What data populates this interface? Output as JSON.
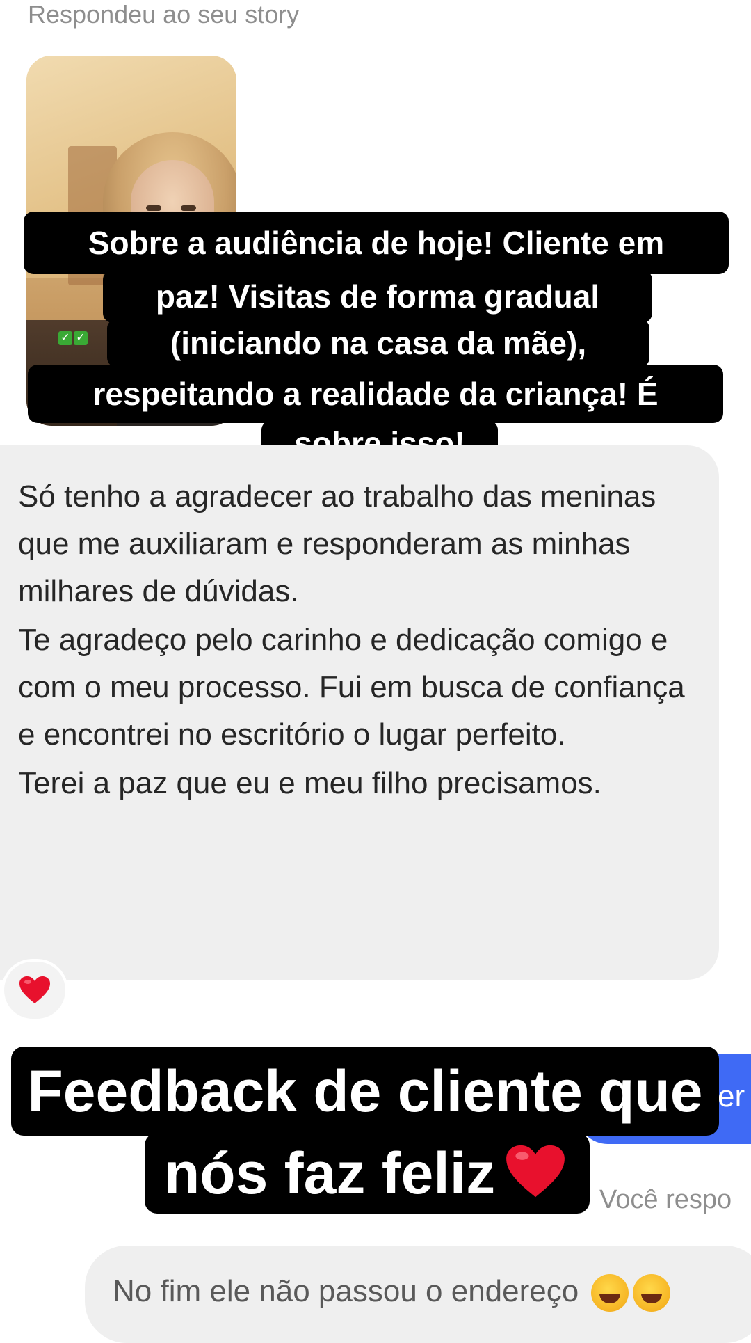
{
  "story_reply": {
    "label": "Respondeu ao seu story",
    "caption_lines": [
      "Sobre a audiência de hoje! Cliente em",
      "paz! Visitas de forma gradual",
      "(iniciando na casa da mãe),",
      "respeitando a realidade da criança! É",
      "sobre isso!"
    ],
    "check_emojis": "✅✅"
  },
  "message": {
    "paragraphs": [
      "Só tenho a agradecer ao trabalho das meninas que me auxiliaram e responderam as minhas milhares de dúvidas.",
      "Te agradeço pelo carinho e dedicação comigo e com o meu processo. Fui em busca de confiança e encontrei no escritório o lugar perfeito.",
      "Terei a paz que eu e meu filho precisamos."
    ],
    "reaction_icon": "red-heart"
  },
  "sticker": {
    "line1": "Feedback de cliente que",
    "line2": "nós faz feliz",
    "heart_icon": "red-heart"
  },
  "sent": {
    "peek_text": "er",
    "replied_label": "Você respo"
  },
  "reply": {
    "text": "No fim ele não passou o endereço",
    "emoji_icon": "face-with-tears-of-joy"
  }
}
